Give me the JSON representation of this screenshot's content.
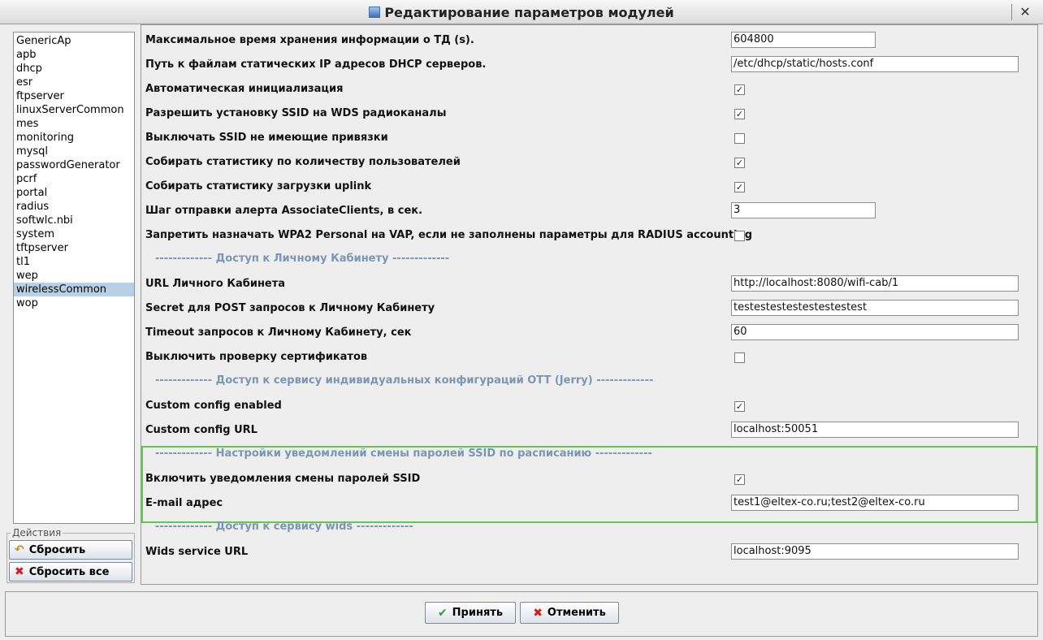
{
  "window": {
    "title": "Редактирование параметров модулей",
    "close_glyph": "✕"
  },
  "modules": [
    {
      "label": "GenericAp",
      "selected": false
    },
    {
      "label": "apb",
      "selected": false
    },
    {
      "label": "dhcp",
      "selected": false
    },
    {
      "label": "esr",
      "selected": false
    },
    {
      "label": "ftpserver",
      "selected": false
    },
    {
      "label": "linuxServerCommon",
      "selected": false
    },
    {
      "label": "mes",
      "selected": false
    },
    {
      "label": "monitoring",
      "selected": false
    },
    {
      "label": "mysql",
      "selected": false
    },
    {
      "label": "passwordGenerator",
      "selected": false
    },
    {
      "label": "pcrf",
      "selected": false
    },
    {
      "label": "portal",
      "selected": false
    },
    {
      "label": "radius",
      "selected": false
    },
    {
      "label": "softwlc.nbi",
      "selected": false
    },
    {
      "label": "system",
      "selected": false
    },
    {
      "label": "tftpserver",
      "selected": false
    },
    {
      "label": "tl1",
      "selected": false
    },
    {
      "label": "wep",
      "selected": false
    },
    {
      "label": "wirelessCommon",
      "selected": true
    },
    {
      "label": "wop",
      "selected": false
    }
  ],
  "actions": {
    "legend": "Действия",
    "reset_label": "Сбросить",
    "reset_all_label": "Сбросить все"
  },
  "params": {
    "max_storage_label": "Максимальное время хранения информации о ТД (s).",
    "max_storage_value": "604800",
    "dhcp_path_label": "Путь к файлам статических IP адресов DHCP серверов.",
    "dhcp_path_value": "/etc/dhcp/static/hosts.conf",
    "auto_init_label": "Автоматическая инициализация",
    "auto_init_checked": true,
    "allow_ssid_wds_label": "Разрешить установку SSID на WDS радиоканалы",
    "allow_ssid_wds_checked": true,
    "disable_ssid_label": "Выключать SSID не имеющие привязки",
    "disable_ssid_checked": false,
    "collect_users_label": "Собирать статистику по количеству пользователей",
    "collect_users_checked": true,
    "collect_uplink_label": "Собирать статистику загрузки uplink",
    "collect_uplink_checked": true,
    "alert_step_label": "Шаг отправки алерта AssociateClients, в сек.",
    "alert_step_value": "3",
    "forbid_wpa2_label": "Запретить назначать WPA2 Personal на VAP, если не заполнены параметры для RADIUS accounting",
    "forbid_wpa2_checked": false,
    "sep_cabinet": "------------- Доступ к Личному Кабинету -------------",
    "cabinet_url_label": "URL Личного Кабинета",
    "cabinet_url_value": "http://localhost:8080/wifi-cab/1",
    "cabinet_secret_label": "Secret для POST запросов к Личному Кабинету",
    "cabinet_secret_value": "testestestestestestestest",
    "cabinet_timeout_label": "Timeout запросов к Личному Кабинету, сек",
    "cabinet_timeout_value": "60",
    "disable_cert_label": "Выключить проверку сертификатов",
    "disable_cert_checked": false,
    "sep_ott": "------------- Доступ к сервису индивидуальных конфигураций OTT (Jerry) -------------",
    "custom_config_enabled_label": "Custom config enabled",
    "custom_config_enabled_checked": true,
    "custom_config_url_label": "Custom config URL",
    "custom_config_url_value": "localhost:50051",
    "sep_ssid_notify": "------------- Настройки уведомлений смены паролей SSID по расписанию -------------",
    "ssid_notify_label": "Включить уведомления смены паролей SSID",
    "ssid_notify_checked": true,
    "email_label": "E-mail адрес",
    "email_value": "test1@eltex-co.ru;test2@eltex-co.ru",
    "sep_wids": "------------- Доступ к сервису wids -------------",
    "wids_url_label": "Wids service URL",
    "wids_url_value": "localhost:9095"
  },
  "footer": {
    "accept_label": "Принять",
    "cancel_label": "Отменить"
  },
  "icons": {
    "check_glyph": "✔",
    "undo_glyph": "↶",
    "x_glyph": "✖",
    "checkmark_glyph": "✓"
  },
  "colors": {
    "separator": "#7b96b4",
    "highlight": "#5fca4e",
    "selection": "#b8cfe5"
  }
}
